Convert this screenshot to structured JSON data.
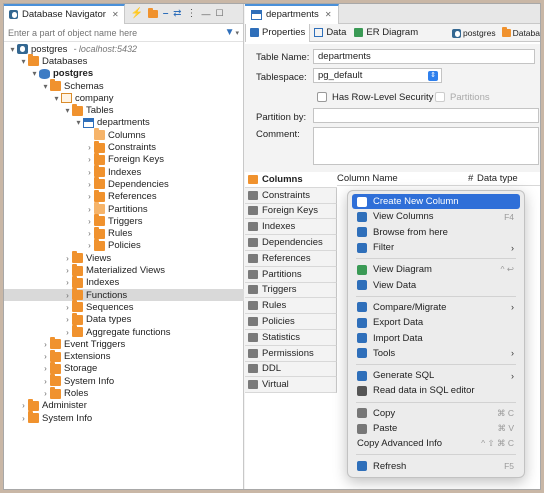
{
  "navigator": {
    "tab_title": "Database Navigator",
    "filter_placeholder": "Enter a part of object name here",
    "tree": [
      {
        "label": "postgres",
        "extra": "- localhost:5432",
        "level": 0,
        "arrow": "down",
        "icon": "pg"
      },
      {
        "label": "Databases",
        "level": 1,
        "arrow": "down",
        "icon": "folder"
      },
      {
        "label": "postgres",
        "level": 2,
        "arrow": "down",
        "icon": "db",
        "bold": true
      },
      {
        "label": "Schemas",
        "level": 3,
        "arrow": "down",
        "icon": "folder"
      },
      {
        "label": "company",
        "level": 4,
        "arrow": "down",
        "icon": "schema"
      },
      {
        "label": "Tables",
        "level": 5,
        "arrow": "down",
        "icon": "folder"
      },
      {
        "label": "departments",
        "level": 6,
        "arrow": "down",
        "icon": "table"
      },
      {
        "label": "Columns",
        "level": 7,
        "arrow": "",
        "icon": "folder-lite"
      },
      {
        "label": "Constraints",
        "level": 7,
        "arrow": "right",
        "icon": "folder"
      },
      {
        "label": "Foreign Keys",
        "level": 7,
        "arrow": "right",
        "icon": "folder"
      },
      {
        "label": "Indexes",
        "level": 7,
        "arrow": "right",
        "icon": "folder"
      },
      {
        "label": "Dependencies",
        "level": 7,
        "arrow": "right",
        "icon": "folder"
      },
      {
        "label": "References",
        "level": 7,
        "arrow": "right",
        "icon": "folder"
      },
      {
        "label": "Partitions",
        "level": 7,
        "arrow": "right",
        "icon": "folder-lite"
      },
      {
        "label": "Triggers",
        "level": 7,
        "arrow": "right",
        "icon": "folder"
      },
      {
        "label": "Rules",
        "level": 7,
        "arrow": "right",
        "icon": "folder"
      },
      {
        "label": "Policies",
        "level": 7,
        "arrow": "right",
        "icon": "folder"
      },
      {
        "label": "Views",
        "level": 5,
        "arrow": "right",
        "icon": "folder"
      },
      {
        "label": "Materialized Views",
        "level": 5,
        "arrow": "right",
        "icon": "folder"
      },
      {
        "label": "Indexes",
        "level": 5,
        "arrow": "right",
        "icon": "folder"
      },
      {
        "label": "Functions",
        "level": 5,
        "arrow": "right",
        "icon": "folder",
        "selected": true
      },
      {
        "label": "Sequences",
        "level": 5,
        "arrow": "right",
        "icon": "folder"
      },
      {
        "label": "Data types",
        "level": 5,
        "arrow": "right",
        "icon": "folder"
      },
      {
        "label": "Aggregate functions",
        "level": 5,
        "arrow": "right",
        "icon": "folder"
      },
      {
        "label": "Event Triggers",
        "level": 3,
        "arrow": "right",
        "icon": "folder"
      },
      {
        "label": "Extensions",
        "level": 3,
        "arrow": "right",
        "icon": "folder"
      },
      {
        "label": "Storage",
        "level": 3,
        "arrow": "right",
        "icon": "folder"
      },
      {
        "label": "System Info",
        "level": 3,
        "arrow": "right",
        "icon": "folder"
      },
      {
        "label": "Roles",
        "level": 3,
        "arrow": "right",
        "icon": "folder"
      },
      {
        "label": "Administer",
        "level": 1,
        "arrow": "right",
        "icon": "folder"
      },
      {
        "label": "System Info",
        "level": 1,
        "arrow": "right",
        "icon": "folder"
      }
    ]
  },
  "editor": {
    "tab_title": "departments",
    "subtabs": [
      "Properties",
      "Data",
      "ER Diagram"
    ],
    "subtab_right": [
      "postgres",
      "Databa"
    ],
    "form": {
      "table_name_label": "Table Name:",
      "table_name_value": "departments",
      "tablespace_label": "Tablespace:",
      "tablespace_value": "pg_default",
      "rls_label": "Has Row-Level Security",
      "partitions_label": "Partitions",
      "partition_by_label": "Partition by:",
      "comment_label": "Comment:"
    },
    "side_tabs": [
      "Columns",
      "Constraints",
      "Foreign Keys",
      "Indexes",
      "Dependencies",
      "References",
      "Partitions",
      "Triggers",
      "Rules",
      "Policies",
      "Statistics",
      "Permissions",
      "DDL",
      "Virtual"
    ],
    "grid_headers": [
      "Column Name",
      "#",
      "Data type"
    ]
  },
  "context_menu": {
    "groups": [
      [
        {
          "label": "Create New Column",
          "shortcut": "",
          "submenu": false,
          "highlighted": true,
          "icon": "new-column-icon"
        },
        {
          "label": "View Columns",
          "shortcut": "F4",
          "submenu": false,
          "icon": "edit-icon"
        },
        {
          "label": "Browse from here",
          "shortcut": "",
          "submenu": false,
          "icon": "database-icon"
        },
        {
          "label": "Filter",
          "shortcut": "",
          "submenu": true,
          "icon": "filter-icon"
        }
      ],
      [
        {
          "label": "View Diagram",
          "shortcut": "^ ↩",
          "submenu": false,
          "icon": "diagram-icon"
        },
        {
          "label": "View Data",
          "shortcut": "",
          "submenu": false,
          "icon": "table-icon"
        }
      ],
      [
        {
          "label": "Compare/Migrate",
          "shortcut": "",
          "submenu": true,
          "icon": "compare-icon"
        },
        {
          "label": "Export Data",
          "shortcut": "",
          "submenu": false,
          "icon": "export-icon"
        },
        {
          "label": "Import Data",
          "shortcut": "",
          "submenu": false,
          "icon": "import-icon"
        },
        {
          "label": "Tools",
          "shortcut": "",
          "submenu": true,
          "icon": "tools-icon"
        }
      ],
      [
        {
          "label": "Generate SQL",
          "shortcut": "",
          "submenu": true,
          "icon": "sql-icon"
        },
        {
          "label": "Read data in SQL editor",
          "shortcut": "",
          "submenu": false,
          "icon": "sql-editor-icon"
        }
      ],
      [
        {
          "label": "Copy",
          "shortcut": "⌘ C",
          "submenu": false,
          "icon": "copy-icon"
        },
        {
          "label": "Paste",
          "shortcut": "⌘ V",
          "submenu": false,
          "icon": "paste-icon"
        },
        {
          "label": "Copy Advanced Info",
          "shortcut": "^ ⇧ ⌘ C",
          "submenu": false,
          "icon": ""
        }
      ],
      [
        {
          "label": "Refresh",
          "shortcut": "F5",
          "submenu": false,
          "icon": "refresh-icon"
        }
      ]
    ]
  },
  "colors": {
    "highlight": "#2f6fd8",
    "folder": "#f0922e",
    "table": "#2f6fba",
    "selected_row": "#d9d9d9"
  }
}
